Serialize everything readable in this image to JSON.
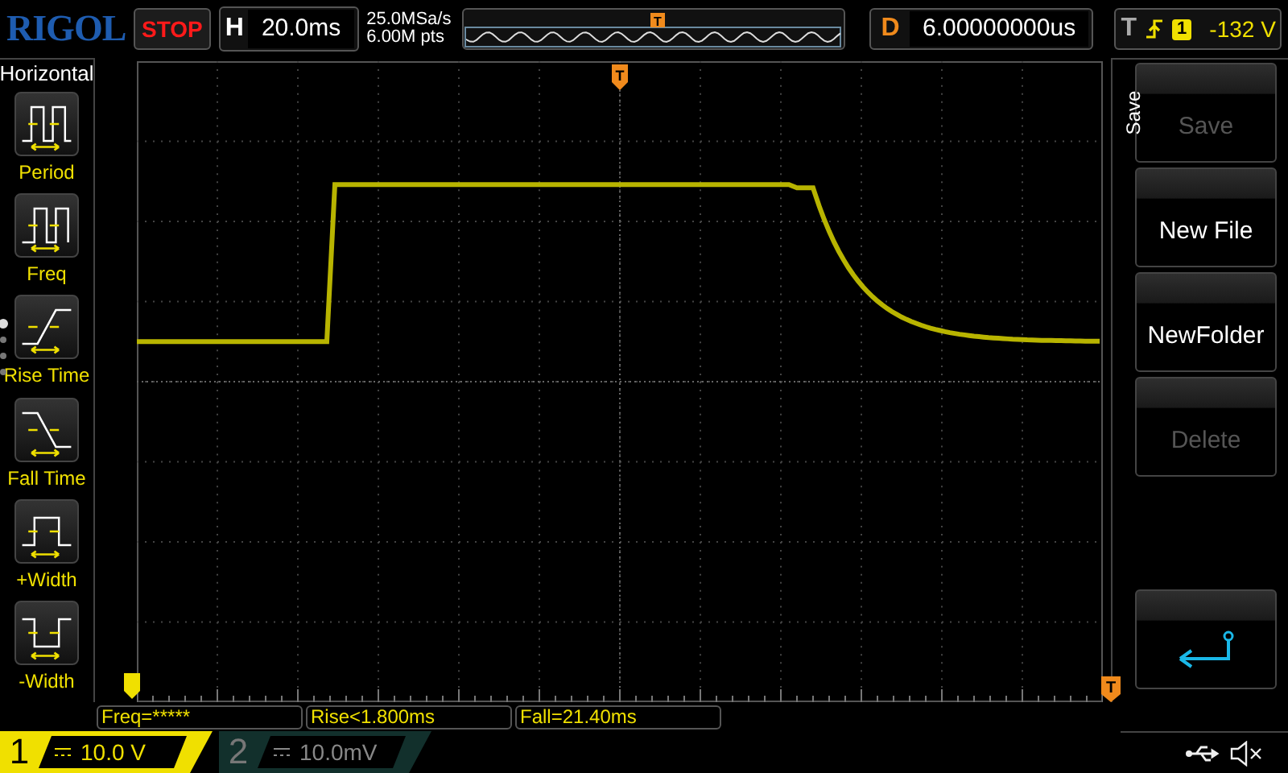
{
  "brand": "RIGOL",
  "run_state": "STOP",
  "horizontal": {
    "label": "H",
    "timebase": "20.0ms",
    "sample_rate": "25.0MSa/s",
    "memory": "6.00M pts"
  },
  "navigator": {
    "trigger_marker": "T"
  },
  "delay": {
    "label": "D",
    "value": "6.00000000us"
  },
  "trigger": {
    "label": "T",
    "channel": "1",
    "level": "-132 V"
  },
  "left_menu": {
    "title": "Horizontal",
    "items": [
      {
        "kind": "period",
        "label": "Period"
      },
      {
        "kind": "freq",
        "label": "Freq"
      },
      {
        "kind": "rise",
        "label": "Rise Time"
      },
      {
        "kind": "fall",
        "label": "Fall Time"
      },
      {
        "kind": "pwidth",
        "label": "+Width"
      },
      {
        "kind": "nwidth",
        "label": "-Width"
      }
    ]
  },
  "screen": {
    "trigger_position_marker": "T",
    "trigger_level_marker": "T"
  },
  "right_menu": {
    "title": "Save",
    "buttons": [
      {
        "kind": "text",
        "label": "Save",
        "disabled": true
      },
      {
        "kind": "text",
        "label": "New File",
        "disabled": false
      },
      {
        "kind": "text",
        "label": "NewFolder",
        "disabled": false
      },
      {
        "kind": "text",
        "label": "Delete",
        "disabled": true
      },
      {
        "kind": "spacer"
      },
      {
        "kind": "back"
      }
    ]
  },
  "measurements": [
    "Freq=*****",
    "Rise<1.800ms",
    "Fall=21.40ms"
  ],
  "channels": [
    {
      "number": "1",
      "scale": "10.0 V",
      "on": true
    },
    {
      "number": "2",
      "scale": "10.0mV",
      "on": false
    }
  ]
}
